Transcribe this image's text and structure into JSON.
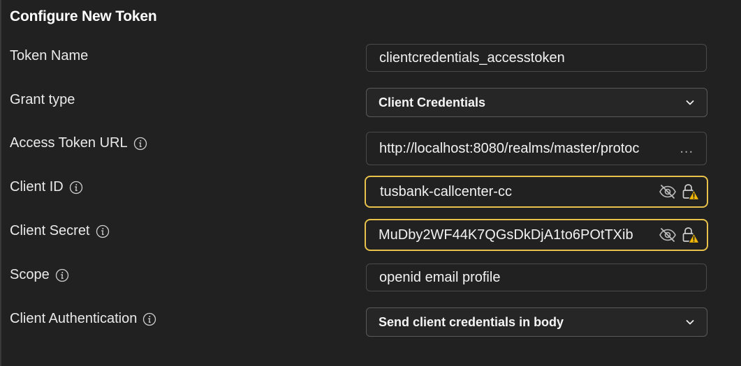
{
  "title": "Configure New Token",
  "fields": {
    "token_name": {
      "label": "Token Name",
      "value": "clientcredentials_accesstoken"
    },
    "grant_type": {
      "label": "Grant type",
      "value": "Client Credentials"
    },
    "access_token_url": {
      "label": "Access Token URL",
      "value": "http://localhost:8080/realms/master/protoc",
      "overflow": "..."
    },
    "client_id": {
      "label": "Client ID",
      "value": "tusbank-callcenter-cc"
    },
    "client_secret": {
      "label": "Client Secret",
      "value": "MuDby2WF44K7QGsDkDjA1to6POtTXib"
    },
    "scope": {
      "label": "Scope",
      "value": "openid email profile"
    },
    "client_authentication": {
      "label": "Client Authentication",
      "value": "Send client credentials in body"
    }
  },
  "colors": {
    "background": "#212121",
    "warning_border": "#e8c24a",
    "warning_icon": "#f2b705"
  }
}
